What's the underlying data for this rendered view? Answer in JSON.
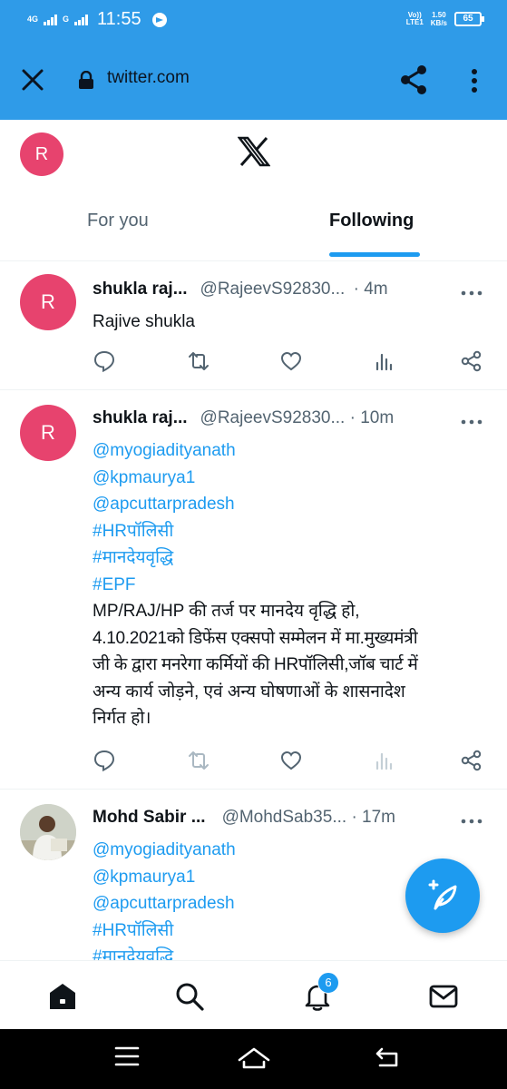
{
  "status_bar": {
    "network_1": "4G",
    "network_2": "G",
    "time": "11:55",
    "volte": "Vo))",
    "lte": "LTE1",
    "speed_value": "1.50",
    "speed_unit": "KB/s",
    "battery": "65"
  },
  "browser": {
    "url": "twitter.com"
  },
  "header": {
    "avatar_letter": "R",
    "tabs": [
      {
        "label": "For you",
        "active": false
      },
      {
        "label": "Following",
        "active": true
      }
    ]
  },
  "tweets": [
    {
      "avatar_letter": "R",
      "name": "shukla raj...",
      "handle": "@RajeevS92830...",
      "time": "· 4m",
      "text": "Rajive shukla"
    },
    {
      "avatar_letter": "R",
      "name": "shukla raj...",
      "handle": "@RajeevS92830...",
      "time": "· 10m",
      "links": [
        "@myogiadityanath",
        "@kpmaurya1",
        "@apcuttarpradesh",
        "#HRपॉलिसी",
        "#मानदेयवृद्धि",
        "#EPF"
      ],
      "text_lines": [
        "MP/RAJ/HP की तर्ज पर मानदेय वृद्धि हो,",
        "4.10.2021को डिफेंस एक्सपो सम्मेलन में मा.मुख्यमंत्री",
        "जी के द्वारा मनरेगा कर्मियों की HRपॉलिसी,जॉब चार्ट में",
        "अन्य कार्य जोड़ने, एवं अन्य घोषणाओं के शासनादेश",
        "निर्गत हो।"
      ]
    },
    {
      "name": "Mohd Sabir ...",
      "handle": "@MohdSab35...",
      "time": "· 17m",
      "links": [
        "@myogiadityanath",
        "@kpmaurya1",
        "@apcuttarpradesh",
        "#HRपॉलिसी",
        "#मानदेयवृद्धि"
      ]
    }
  ],
  "bottom_nav": {
    "notifications_badge": "6"
  },
  "colors": {
    "browser_bar": "#2f9be8",
    "accent": "#1d9bf0",
    "avatar": "#e7436e"
  }
}
